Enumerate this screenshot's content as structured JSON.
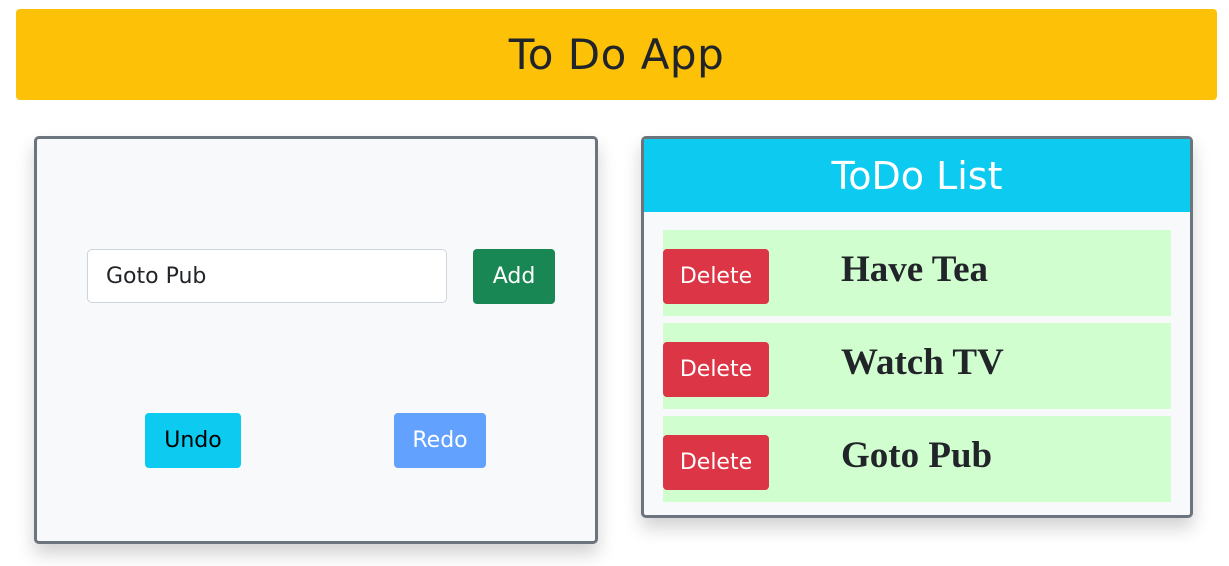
{
  "header": {
    "title": "To Do App"
  },
  "input_panel": {
    "input_value": "Goto Pub",
    "add_label": "Add",
    "undo_label": "Undo",
    "redo_label": "Redo"
  },
  "list_panel": {
    "title": "ToDo List",
    "items": [
      {
        "text": "Have Tea",
        "delete_label": "Delete"
      },
      {
        "text": "Watch TV",
        "delete_label": "Delete"
      },
      {
        "text": "Goto Pub",
        "delete_label": "Delete"
      }
    ]
  },
  "colors": {
    "header_bg": "#fdc107",
    "add_button": "#198754",
    "undo_button": "#0dcaf0",
    "redo_button": "#62a1fe",
    "delete_button": "#dc3545",
    "list_header_bg": "#0dcaf0",
    "item_bg": "#d1fecf",
    "panel_border": "#6c757d"
  }
}
